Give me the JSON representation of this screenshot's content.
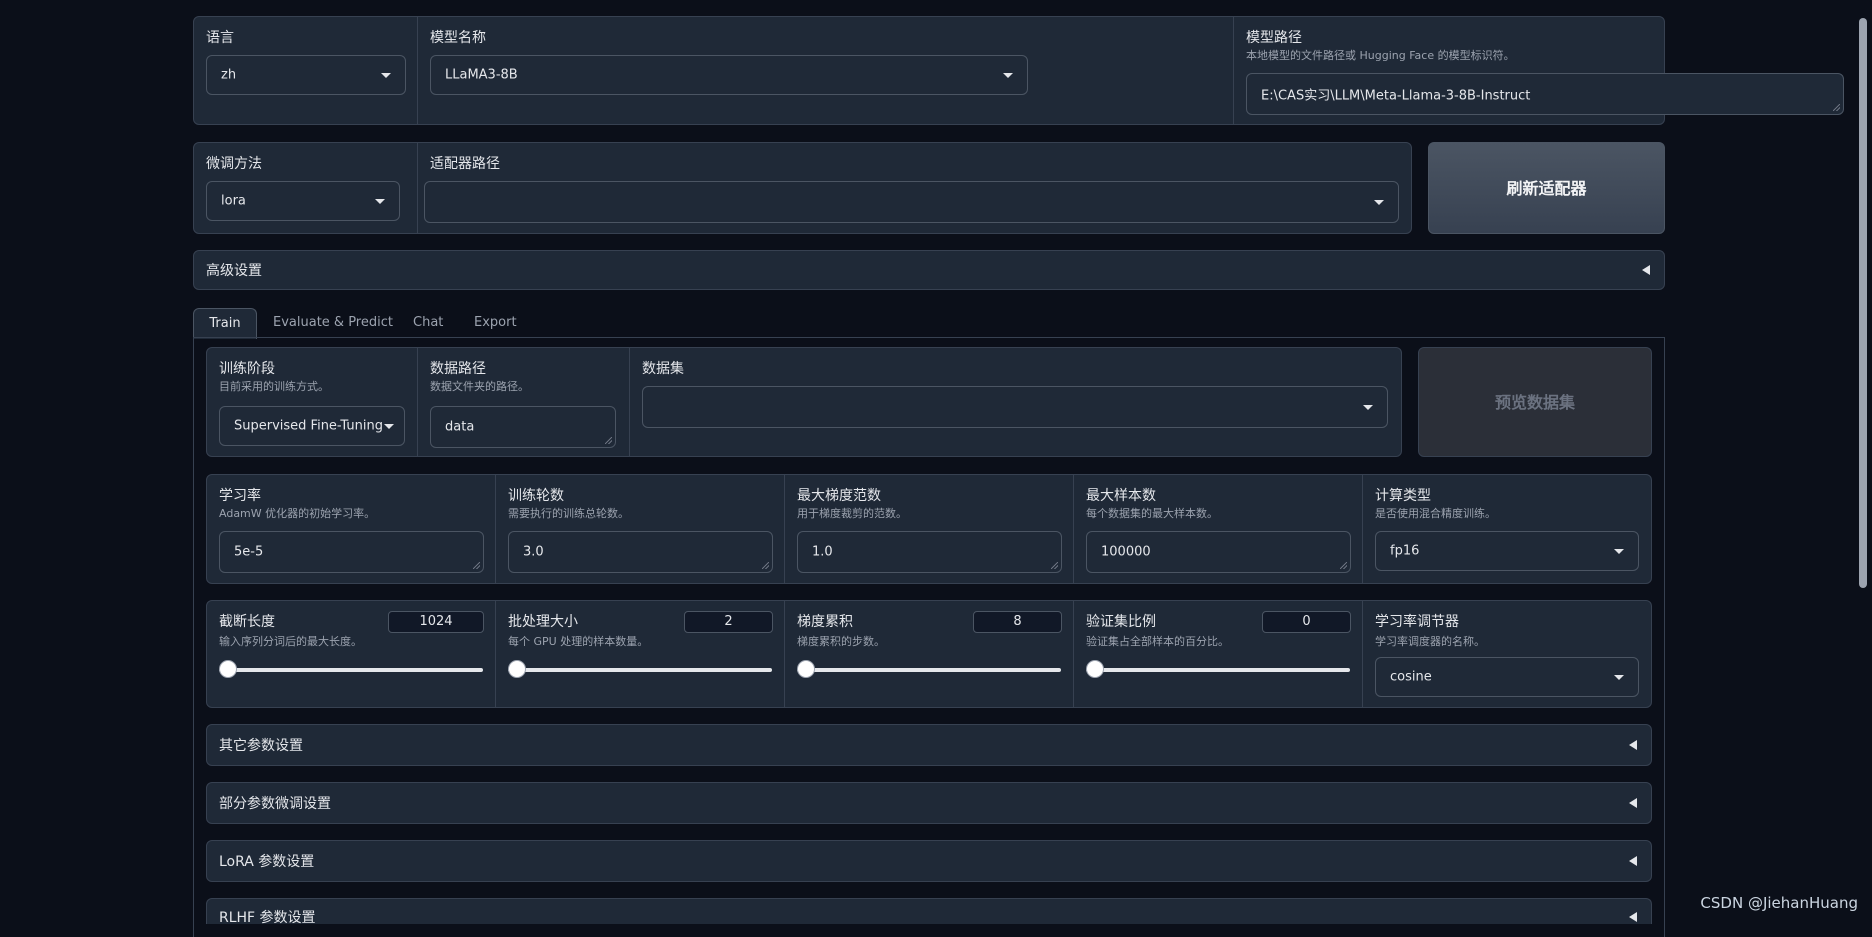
{
  "top_row": {
    "language": {
      "label": "语言",
      "value": "zh"
    },
    "model_name": {
      "label": "模型名称",
      "value": "LLaMA3-8B"
    },
    "model_path": {
      "label": "模型路径",
      "info": "本地模型的文件路径或 Hugging Face 的模型标识符。",
      "value": "E:\\CAS实习\\LLM\\Meta-Llama-3-8B-Instruct"
    }
  },
  "second_row": {
    "finetune_method": {
      "label": "微调方法",
      "value": "lora"
    },
    "adapter_path": {
      "label": "适配器路径",
      "value": ""
    },
    "refresh_button": "刷新适配器"
  },
  "advanced_settings": "高级设置",
  "tabs": [
    "Train",
    "Evaluate & Predict",
    "Chat",
    "Export"
  ],
  "train": {
    "stage": {
      "label": "训练阶段",
      "info": "目前采用的训练方式。",
      "value": "Supervised Fine-Tuning"
    },
    "dataset_dir": {
      "label": "数据路径",
      "info": "数据文件夹的路径。",
      "value": "data"
    },
    "dataset": {
      "label": "数据集",
      "value": ""
    },
    "preview_button": "预览数据集",
    "learning_rate": {
      "label": "学习率",
      "info": "AdamW 优化器的初始学习率。",
      "value": "5e-5"
    },
    "epochs": {
      "label": "训练轮数",
      "info": "需要执行的训练总轮数。",
      "value": "3.0"
    },
    "max_grad_norm": {
      "label": "最大梯度范数",
      "info": "用于梯度裁剪的范数。",
      "value": "1.0"
    },
    "max_samples": {
      "label": "最大样本数",
      "info": "每个数据集的最大样本数。",
      "value": "100000"
    },
    "compute_type": {
      "label": "计算类型",
      "info": "是否使用混合精度训练。",
      "value": "fp16"
    },
    "cutoff_len": {
      "label": "截断长度",
      "info": "输入序列分词后的最大长度。",
      "value": "1024",
      "fraction": 0.0
    },
    "batch_size": {
      "label": "批处理大小",
      "info": "每个 GPU 处理的样本数量。",
      "value": "2",
      "fraction": 0.0
    },
    "grad_accum": {
      "label": "梯度累积",
      "info": "梯度累积的步数。",
      "value": "8",
      "fraction": 0.0
    },
    "val_size": {
      "label": "验证集比例",
      "info": "验证集占全部样本的百分比。",
      "value": "0",
      "fraction": 0.0
    },
    "lr_scheduler": {
      "label": "学习率调节器",
      "info": "学习率调度器的名称。",
      "value": "cosine"
    },
    "accordions": [
      "其它参数设置",
      "部分参数微调设置",
      "LoRA 参数设置",
      "RLHF 参数设置"
    ]
  },
  "watermark": "CSDN @JiehanHuang"
}
